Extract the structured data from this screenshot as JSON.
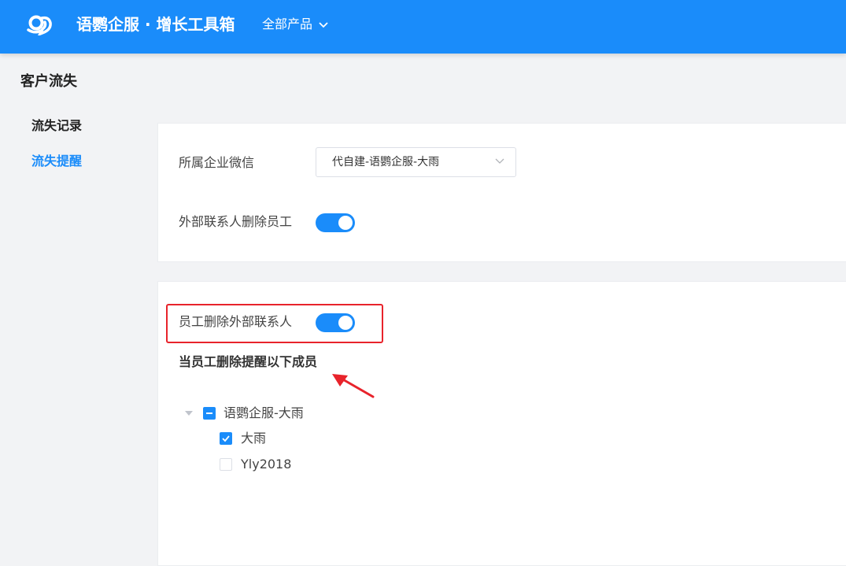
{
  "header": {
    "brand": "语鹦企服 · 增长工具箱",
    "products_label": "全部产品",
    "bg_color": "#1a8cfa"
  },
  "sidebar": {
    "title": "客户流失",
    "items": [
      {
        "label": "流失记录",
        "active": false
      },
      {
        "label": "流失提醒",
        "active": true
      }
    ]
  },
  "settings": {
    "enterprise_label": "所属企业微信",
    "enterprise_value": "代自建-语鹦企服-大雨",
    "external_delete_label": "外部联系人删除员工",
    "external_delete_on": true
  },
  "reminder": {
    "employee_delete_label": "员工删除外部联系人",
    "employee_delete_on": true,
    "members_title": "当员工删除提醒以下成员",
    "tree": {
      "root_label": "语鹦企服-大雨",
      "root_state": "indeterminate",
      "children": [
        {
          "label": "大雨",
          "checked": true
        },
        {
          "label": "Yly2018",
          "checked": false
        }
      ]
    }
  },
  "colors": {
    "accent": "#1a8cfa",
    "highlight": "#e8232b"
  }
}
